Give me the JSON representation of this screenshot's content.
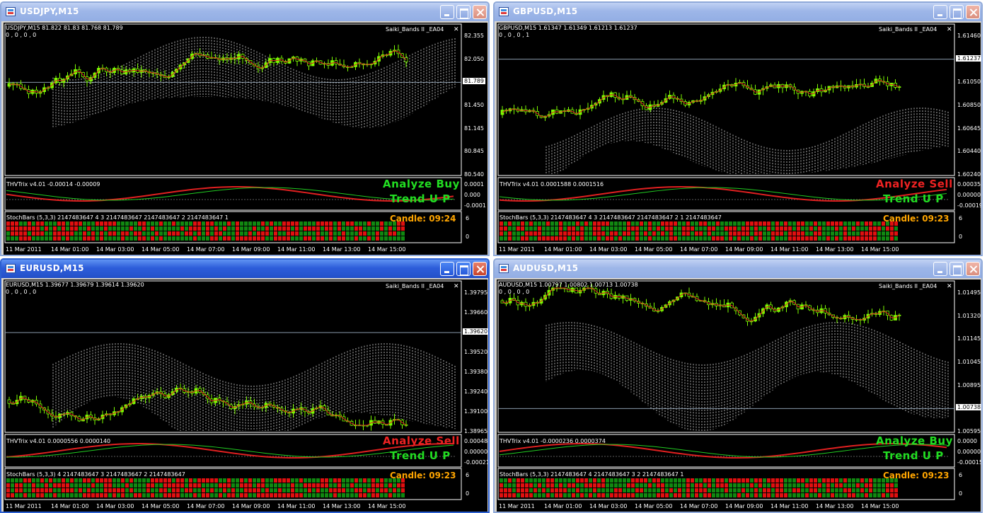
{
  "windows": [
    {
      "title": "USDJPY,M15",
      "active": false,
      "info": "USDJPY,M15  81.822 81.83  81.768 81.789",
      "info2": "0 , 0 , 0 , 0",
      "ea": "Saiki_Bands II _EA04",
      "yticks": [
        "82.355",
        "82.050",
        "81.789",
        "81.450",
        "81.145",
        "80.845",
        "80.540"
      ],
      "price_tag": "81.789",
      "ind1": "THVTrix v4.01 -0.00014 -0.00009",
      "ind1_ticks": [
        "0.0001",
        "0.000",
        "-0.0001"
      ],
      "ind2": "StochBars (5,3,3) 2147483647 4 3 2147483647 2147483647 2 2147483647 1",
      "ind2_ticks": [
        "6",
        "0"
      ],
      "signal1": "Analyze Buy",
      "signal1_color": "#22dd22",
      "signal2": "Trend U P",
      "candle": "Candle:  09:24",
      "xticks": [
        "11 Mar 2011",
        "14 Mar 01:00",
        "14 Mar 03:00",
        "14 Mar 05:00",
        "14 Mar 07:00",
        "14 Mar 09:00",
        "14 Mar 11:00",
        "14 Mar 13:00",
        "14 Mar 15:00"
      ]
    },
    {
      "title": "GBPUSD,M15",
      "active": false,
      "info": "GBPUSD,M15  1.61347 1.61349 1.61213 1.61237",
      "info2": "0 , 0 , 0 , 1",
      "ea": "Saiki_Bands II _EA04",
      "yticks": [
        "1.61460",
        "1.61237",
        "1.61050",
        "1.60850",
        "1.60645",
        "1.60440",
        "1.60240"
      ],
      "price_tag": "1.61237",
      "ind1": "THVTrix v4.01 0.0001588 0.0001516",
      "ind1_ticks": [
        "0.000353",
        "0.00000",
        "-0.00019"
      ],
      "ind2": "StochBars (5,3,3) 2147483647 4 3 2147483647 2147483647 2 1 2147483647",
      "ind2_ticks": [
        "6",
        "0"
      ],
      "signal1": "Analyze Sell",
      "signal1_color": "#ee2222",
      "signal2": "Trend U P",
      "candle": "Candle:  09:23",
      "xticks": [
        "11 Mar 2011",
        "14 Mar 01:00",
        "14 Mar 03:00",
        "14 Mar 05:00",
        "14 Mar 07:00",
        "14 Mar 09:00",
        "14 Mar 11:00",
        "14 Mar 13:00",
        "14 Mar 15:00"
      ]
    },
    {
      "title": "EURUSD,M15",
      "active": true,
      "info": "EURUSD,M15  1.39677 1.39679 1.39614 1.39620",
      "info2": "0 , 0 , 0 , 0",
      "ea": "Saiki_Bands II _EA04",
      "yticks": [
        "1.39795",
        "1.39660",
        "1.39620",
        "1.39520",
        "1.39380",
        "1.39240",
        "1.39100",
        "1.38965"
      ],
      "price_tag": "1.39620",
      "ind1": "THVTrix v4.01 0.0000556 0.0000140",
      "ind1_ticks": [
        "0.000488",
        "0.00000",
        "-0.00021"
      ],
      "ind2": "StochBars (5,3,3) 4 2147483647 3 2147483647 2 2147483647",
      "ind2_ticks": [
        "6",
        "0"
      ],
      "signal1": "Analyze Sell",
      "signal1_color": "#ee2222",
      "signal2": "Trend U P",
      "candle": "Candle:  09:23",
      "xticks": [
        "11 Mar 2011",
        "14 Mar 01:00",
        "14 Mar 03:00",
        "14 Mar 05:00",
        "14 Mar 07:00",
        "14 Mar 09:00",
        "14 Mar 11:00",
        "14 Mar 13:00",
        "14 Mar 15:00"
      ]
    },
    {
      "title": "AUDUSD,M15",
      "active": false,
      "info": "AUDUSD,M15  1.00797 1.00802 1.00713 1.00738",
      "info2": "0 , 0 , 0 , 0",
      "ea": "Saiki_Bands II _EA04",
      "yticks": [
        "1.01495",
        "1.01320",
        "1.01145",
        "1.01045",
        "1.00895",
        "1.00738",
        "1.00595"
      ],
      "price_tag": "1.00738",
      "ind1": "THVTrix v4.01 -0.0000236 0.0000374",
      "ind1_ticks": [
        "0.0000",
        "0.00000",
        "-0.00015"
      ],
      "ind2": "StochBars (5,3,3) 2147483647 4 2147483647 3 2 2147483647 1",
      "ind2_ticks": [
        "6",
        "0"
      ],
      "signal1": "Analyze Buy",
      "signal1_color": "#22dd22",
      "signal2": "Trend U P",
      "candle": "Candle:  09:23",
      "xticks": [
        "11 Mar 2011",
        "14 Mar 01:00",
        "14 Mar 03:00",
        "14 Mar 05:00",
        "14 Mar 07:00",
        "14 Mar 09:00",
        "14 Mar 11:00",
        "14 Mar 13:00",
        "14 Mar 15:00"
      ]
    }
  ],
  "colors": {
    "bull": "#7cfc00",
    "bear": "#000000",
    "trend_green": "#22cc22",
    "trend_red": "#e02020",
    "stoch_red": "#e01010",
    "stoch_green": "#118811",
    "cloud": "#ffffff",
    "candle_label": "#ffa500"
  }
}
